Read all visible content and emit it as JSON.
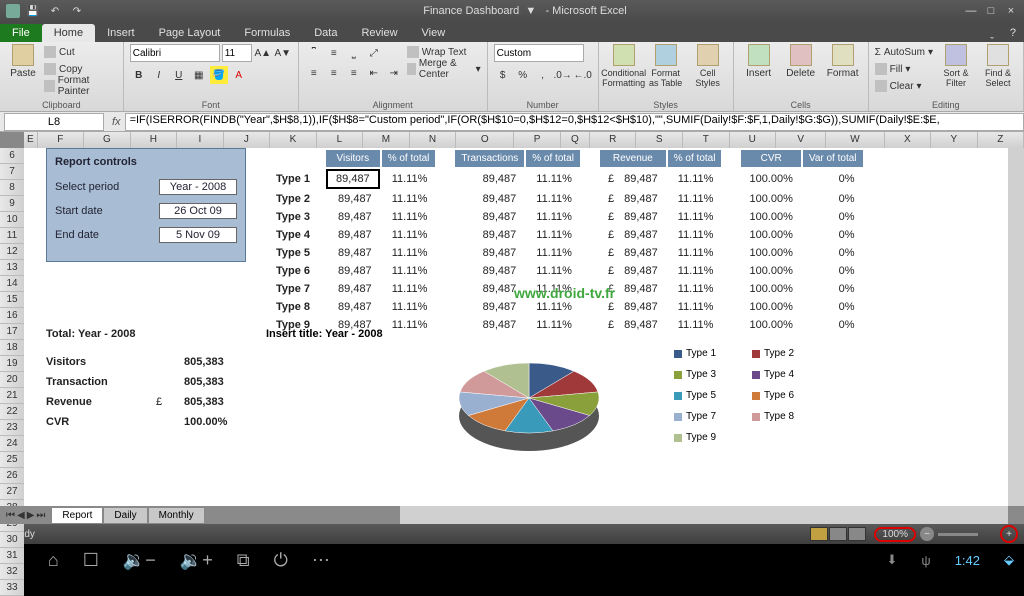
{
  "window": {
    "title_doc": "Finance Dashboard",
    "title_app": "- Microsoft Excel"
  },
  "tabs": {
    "file": "File",
    "home": "Home",
    "insert": "Insert",
    "page_layout": "Page Layout",
    "formulas": "Formulas",
    "data": "Data",
    "review": "Review",
    "view": "View"
  },
  "ribbon": {
    "clipboard": {
      "label": "Clipboard",
      "paste": "Paste",
      "cut": "Cut",
      "copy": "Copy",
      "format_painter": "Format Painter"
    },
    "font": {
      "label": "Font",
      "name": "Calibri",
      "size": "11"
    },
    "alignment": {
      "label": "Alignment",
      "wrap": "Wrap Text",
      "merge": "Merge & Center"
    },
    "number": {
      "label": "Number",
      "format": "Custom"
    },
    "styles": {
      "label": "Styles",
      "cond": "Conditional Formatting",
      "fmt_table": "Format as Table",
      "cell_styles": "Cell Styles"
    },
    "cells": {
      "label": "Cells",
      "insert": "Insert",
      "delete": "Delete",
      "format": "Format"
    },
    "editing": {
      "label": "Editing",
      "autosum": "AutoSum",
      "fill": "Fill",
      "clear": "Clear",
      "sort": "Sort & Filter",
      "find": "Find & Select"
    }
  },
  "formula_bar": {
    "cell_ref": "L8",
    "formula": "=IF(ISERROR(FINDB(\"Year\",$H$8,1)),IF($H$8=\"Custom period\",IF(OR($H$10=0,$H$12=0,$H$12<$H$10),\"\",SUMIF(Daily!$F:$F,1,Daily!$G:$G)),SUMIF(Daily!$E:$E,"
  },
  "columns": [
    "E",
    "F",
    "G",
    "H",
    "I",
    "J",
    "K",
    "L",
    "M",
    "N",
    "O",
    "P",
    "Q",
    "R",
    "S",
    "T",
    "U",
    "V",
    "W",
    "X",
    "Y",
    "Z"
  ],
  "rows_start": 6,
  "rows_end": 33,
  "report_controls": {
    "title": "Report controls",
    "select_label": "Select period",
    "select_value": "Year - 2008",
    "start_label": "Start date",
    "start_value": "26 Oct 09",
    "end_label": "End date",
    "end_value": "5 Nov 09"
  },
  "table_headers": {
    "visitors": "Visitors",
    "pct1": "% of total",
    "transactions": "Transactions",
    "pct2": "% of total",
    "revenue": "Revenue",
    "pct3": "% of total",
    "cvr": "CVR",
    "var": "Var of total"
  },
  "table_rows": [
    {
      "label": "Type 1",
      "v": "89,487",
      "p1": "11.11%",
      "t": "89,487",
      "p2": "11.11%",
      "c": "£",
      "r": "89,487",
      "p3": "11.11%",
      "cvr": "100.00%",
      "var": "0%"
    },
    {
      "label": "Type 2",
      "v": "89,487",
      "p1": "11.11%",
      "t": "89,487",
      "p2": "11.11%",
      "c": "£",
      "r": "89,487",
      "p3": "11.11%",
      "cvr": "100.00%",
      "var": "0%"
    },
    {
      "label": "Type 3",
      "v": "89,487",
      "p1": "11.11%",
      "t": "89,487",
      "p2": "11.11%",
      "c": "£",
      "r": "89,487",
      "p3": "11.11%",
      "cvr": "100.00%",
      "var": "0%"
    },
    {
      "label": "Type 4",
      "v": "89,487",
      "p1": "11.11%",
      "t": "89,487",
      "p2": "11.11%",
      "c": "£",
      "r": "89,487",
      "p3": "11.11%",
      "cvr": "100.00%",
      "var": "0%"
    },
    {
      "label": "Type 5",
      "v": "89,487",
      "p1": "11.11%",
      "t": "89,487",
      "p2": "11.11%",
      "c": "£",
      "r": "89,487",
      "p3": "11.11%",
      "cvr": "100.00%",
      "var": "0%"
    },
    {
      "label": "Type 6",
      "v": "89,487",
      "p1": "11.11%",
      "t": "89,487",
      "p2": "11.11%",
      "c": "£",
      "r": "89,487",
      "p3": "11.11%",
      "cvr": "100.00%",
      "var": "0%"
    },
    {
      "label": "Type 7",
      "v": "89,487",
      "p1": "11.11%",
      "t": "89,487",
      "p2": "11.11%",
      "c": "£",
      "r": "89,487",
      "p3": "11.11%",
      "cvr": "100.00%",
      "var": "0%"
    },
    {
      "label": "Type 8",
      "v": "89,487",
      "p1": "11.11%",
      "t": "89,487",
      "p2": "11.11%",
      "c": "£",
      "r": "89,487",
      "p3": "11.11%",
      "cvr": "100.00%",
      "var": "0%"
    },
    {
      "label": "Type 9",
      "v": "89,487",
      "p1": "11.11%",
      "t": "89,487",
      "p2": "11.11%",
      "c": "£",
      "r": "89,487",
      "p3": "11.11%",
      "cvr": "100.00%",
      "var": "0%"
    }
  ],
  "totals": {
    "title": "Total: Year - 2008",
    "rows": [
      {
        "label": "Visitors",
        "cur": "",
        "val": "805,383"
      },
      {
        "label": "Transaction",
        "cur": "",
        "val": "805,383"
      },
      {
        "label": "Revenue",
        "cur": "£",
        "val": "805,383"
      },
      {
        "label": "CVR",
        "cur": "",
        "val": "100.00%"
      }
    ]
  },
  "insert_title": "Insert title: Year - 2008",
  "chart_legend": [
    {
      "name": "Type 1",
      "color": "#3a5a8a"
    },
    {
      "name": "Type 2",
      "color": "#a03a3a"
    },
    {
      "name": "Type 3",
      "color": "#8aa03a"
    },
    {
      "name": "Type 4",
      "color": "#6a4a8a"
    },
    {
      "name": "Type 5",
      "color": "#3a9aba"
    },
    {
      "name": "Type 6",
      "color": "#d07a3a"
    },
    {
      "name": "Type 7",
      "color": "#9ab0d0"
    },
    {
      "name": "Type 8",
      "color": "#d09a9a"
    },
    {
      "name": "Type 9",
      "color": "#b0c090"
    }
  ],
  "chart_data": {
    "type": "pie",
    "title": "",
    "series": [
      {
        "name": "Type 1",
        "value": 11.11
      },
      {
        "name": "Type 2",
        "value": 11.11
      },
      {
        "name": "Type 3",
        "value": 11.11
      },
      {
        "name": "Type 4",
        "value": 11.11
      },
      {
        "name": "Type 5",
        "value": 11.11
      },
      {
        "name": "Type 6",
        "value": 11.11
      },
      {
        "name": "Type 7",
        "value": 11.11
      },
      {
        "name": "Type 8",
        "value": 11.11
      },
      {
        "name": "Type 9",
        "value": 11.11
      }
    ]
  },
  "watermark": "www.droid-tv.fr",
  "sheet_tabs": {
    "active": "Report",
    "others": [
      "Daily",
      "Monthly"
    ]
  },
  "status": {
    "ready": "Ready",
    "zoom": "100%"
  },
  "android": {
    "time": "1:42"
  }
}
